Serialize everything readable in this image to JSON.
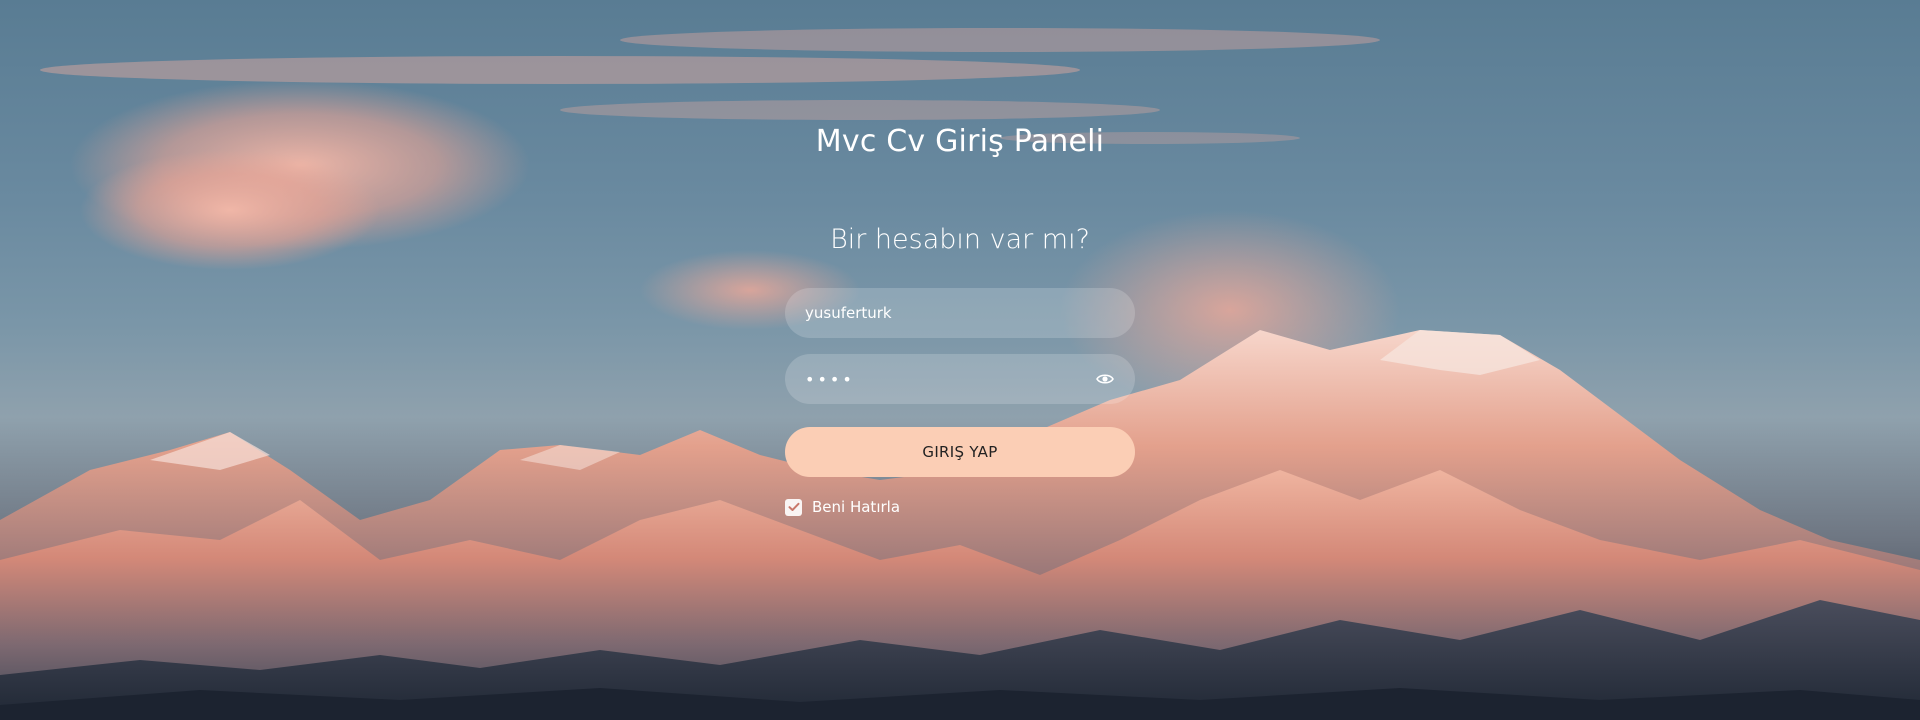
{
  "panel": {
    "title": "Mvc Cv Giriş Paneli",
    "subtitle": "Bir hesabın var mı?"
  },
  "login_form": {
    "username_value": "yusuferturk",
    "password_value": "••••",
    "password_icon": "eye-icon",
    "submit_label": "GIRIŞ YAP",
    "remember_label": "Beni Hatırla",
    "remember_checked": true
  },
  "colors": {
    "button_bg": "#fbceb5",
    "sky": "#597c93",
    "text": "#ffffff"
  }
}
